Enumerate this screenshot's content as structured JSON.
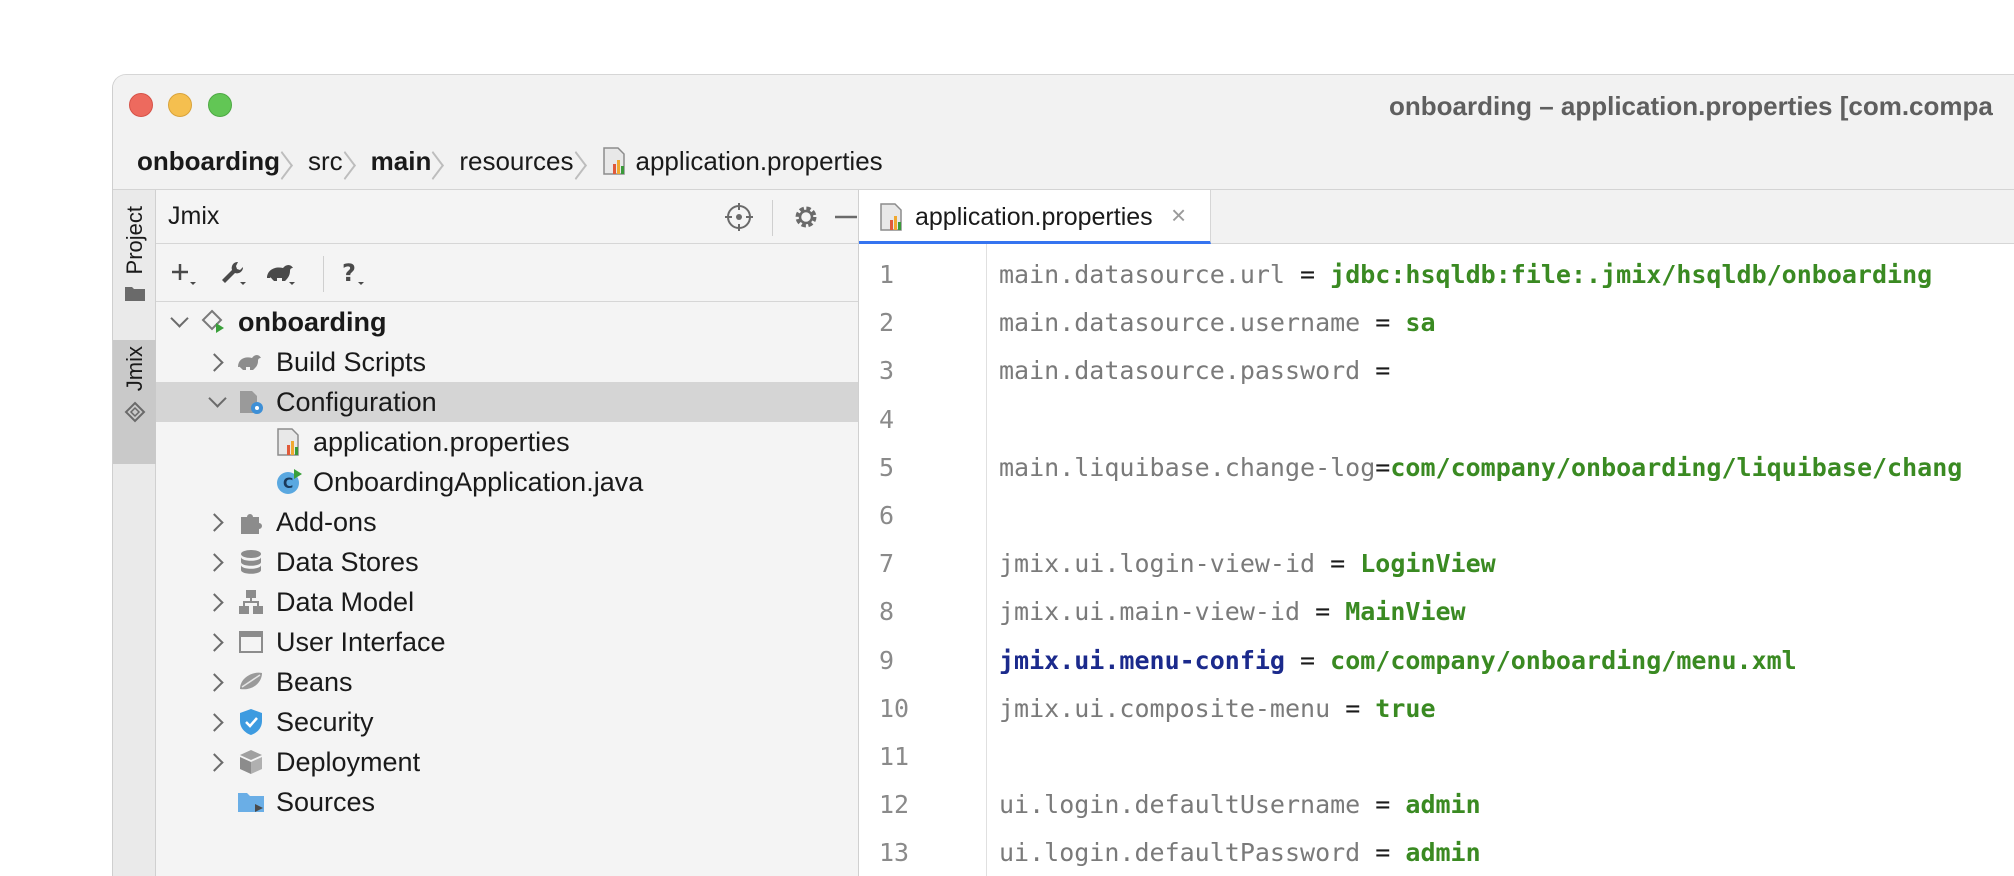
{
  "window": {
    "title": "onboarding – application.properties [com.compa"
  },
  "breadcrumbs": [
    {
      "label": "onboarding",
      "bold": true
    },
    {
      "label": "src",
      "bold": false
    },
    {
      "label": "main",
      "bold": true
    },
    {
      "label": "resources",
      "bold": false
    },
    {
      "label": "application.properties",
      "bold": false
    }
  ],
  "sidestrip": {
    "project_label": "Project",
    "jmix_label": "Jmix"
  },
  "toolwindow": {
    "title": "Jmix",
    "tree": {
      "root": "onboarding",
      "build_scripts": "Build Scripts",
      "configuration": "Configuration",
      "app_properties": "application.properties",
      "app_java": "OnboardingApplication.java",
      "addons": "Add-ons",
      "data_stores": "Data Stores",
      "data_model": "Data Model",
      "user_interface": "User Interface",
      "beans": "Beans",
      "security": "Security",
      "deployment": "Deployment",
      "sources": "Sources"
    }
  },
  "editor": {
    "tab_label": "application.properties",
    "tab_close": "×",
    "lines": [
      {
        "n": "1",
        "key": "main.datasource.url",
        "sep": " = ",
        "value": "jdbc:hsqldb:file:.jmix/hsqldb/onboarding"
      },
      {
        "n": "2",
        "key": "main.datasource.username",
        "sep": " = ",
        "value": "sa"
      },
      {
        "n": "3",
        "key": "main.datasource.password",
        "sep": " =",
        "value": ""
      },
      {
        "n": "4",
        "key": "",
        "sep": "",
        "value": ""
      },
      {
        "n": "5",
        "key": "main.liquibase.change-log",
        "sep": "=",
        "value": "com/company/onboarding/liquibase/chang"
      },
      {
        "n": "6",
        "key": "",
        "sep": "",
        "value": ""
      },
      {
        "n": "7",
        "key": "jmix.ui.login-view-id",
        "sep": " = ",
        "value": "LoginView"
      },
      {
        "n": "8",
        "key": "jmix.ui.main-view-id",
        "sep": " = ",
        "value": "MainView"
      },
      {
        "n": "9",
        "key": "jmix.ui.menu-config",
        "sep": " = ",
        "value": "com/company/onboarding/menu.xml"
      },
      {
        "n": "10",
        "key": "jmix.ui.composite-menu",
        "sep": " = ",
        "value": "true"
      },
      {
        "n": "11",
        "key": "",
        "sep": "",
        "value": ""
      },
      {
        "n": "12",
        "key": "ui.login.defaultUsername",
        "sep": " = ",
        "value": "admin"
      },
      {
        "n": "13",
        "key": "ui.login.defaultPassword",
        "sep": " = ",
        "value": "admin"
      }
    ]
  },
  "colors": {
    "accent": "#3574f0",
    "string_value": "#3a8a22",
    "key": "#7a7a7a",
    "highlight_key": "#1b2a8c"
  }
}
